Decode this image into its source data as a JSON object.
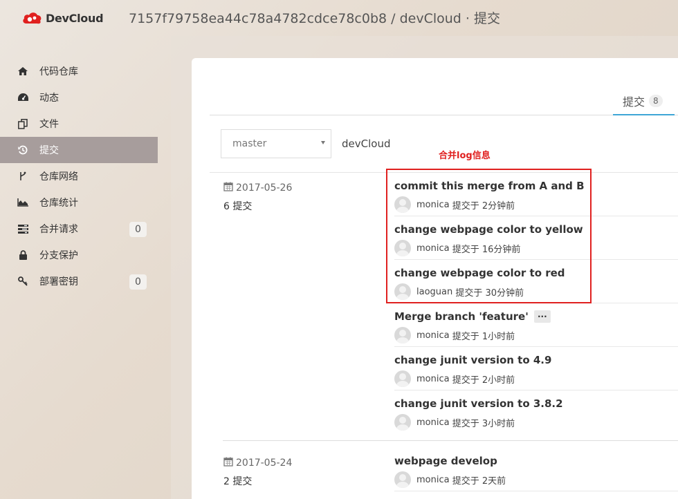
{
  "header": {
    "logo_text": "DevCloud",
    "title": "7157f79758ea44c78a4782cdce78c0b8 / devCloud · 提交"
  },
  "sidebar": {
    "items": [
      {
        "label": "代码仓库",
        "icon": "home-icon"
      },
      {
        "label": "动态",
        "icon": "dashboard-icon"
      },
      {
        "label": "文件",
        "icon": "files-icon"
      },
      {
        "label": "提交",
        "icon": "history-icon",
        "active": true
      },
      {
        "label": "仓库网络",
        "icon": "fork-icon"
      },
      {
        "label": "仓库统计",
        "icon": "area-chart-icon"
      },
      {
        "label": "合并请求",
        "icon": "tasks-icon",
        "badge": "0"
      },
      {
        "label": "分支保护",
        "icon": "lock-icon"
      },
      {
        "label": "部署密钥",
        "icon": "key-icon",
        "badge": "0"
      }
    ]
  },
  "tab": {
    "label": "提交",
    "count": "8"
  },
  "filter": {
    "branch": "master",
    "repo": "devCloud"
  },
  "annotation": "合并log信息",
  "groups": [
    {
      "date": "2017-05-26",
      "count_label": "6 提交",
      "commits": [
        {
          "title": "commit this merge from A and B",
          "author": "monica",
          "action": "提交于",
          "time": "2分钟前"
        },
        {
          "title": "change webpage color to yellow",
          "author": "monica",
          "action": "提交于",
          "time": "16分钟前"
        },
        {
          "title": "change webpage color to red",
          "author": "laoguan",
          "action": "提交于",
          "time": "30分钟前"
        },
        {
          "title": "Merge branch 'feature'",
          "author": "monica",
          "action": "提交于",
          "time": "1小时前",
          "ellipsis": "..."
        },
        {
          "title": "change junit version to 4.9",
          "author": "monica",
          "action": "提交于",
          "time": "2小时前"
        },
        {
          "title": "change junit version to 3.8.2",
          "author": "monica",
          "action": "提交于",
          "time": "3小时前"
        }
      ]
    },
    {
      "date": "2017-05-24",
      "count_label": "2 提交",
      "commits": [
        {
          "title": "webpage develop",
          "author": "monica",
          "action": "提交于",
          "time": "2天前"
        }
      ]
    }
  ],
  "colors": {
    "accent": "#3ea6d6",
    "annotation": "#e0201f",
    "active_nav": "#a79d9c",
    "logo_red": "#e0201f"
  }
}
